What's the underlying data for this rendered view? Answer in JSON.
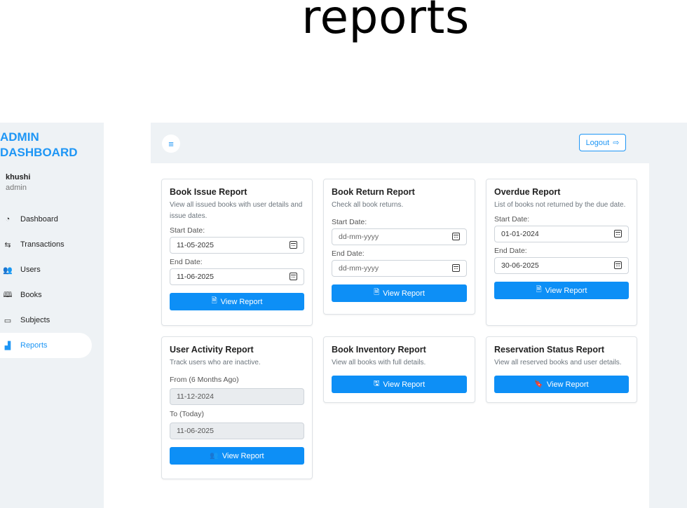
{
  "slide": {
    "title": "reports"
  },
  "sidebar": {
    "brand": "ADMIN DASHBOARD",
    "user": {
      "name": "khushi",
      "role": "admin"
    },
    "items": [
      {
        "label": "Dashboard",
        "icon": "gauge-icon"
      },
      {
        "label": "Transactions",
        "icon": "swap-icon"
      },
      {
        "label": "Users",
        "icon": "users-icon"
      },
      {
        "label": "Books",
        "icon": "book-icon"
      },
      {
        "label": "Subjects",
        "icon": "box-icon"
      },
      {
        "label": "Reports",
        "icon": "bar-chart-icon",
        "active": true
      }
    ]
  },
  "header": {
    "logout_label": "Logout"
  },
  "reports": {
    "issue": {
      "title": "Book Issue Report",
      "desc": "View all issued books with user details and issue dates.",
      "start_label": "Start Date:",
      "start_value": "11-05-2025",
      "end_label": "End Date:",
      "end_value": "11-06-2025",
      "button": "View Report"
    },
    "return": {
      "title": "Book Return Report",
      "desc": "Check all book returns.",
      "start_label": "Start Date:",
      "start_placeholder": "dd-mm-yyyy",
      "end_label": "End Date:",
      "end_placeholder": "dd-mm-yyyy",
      "button": "View Report"
    },
    "overdue": {
      "title": "Overdue Report",
      "desc": "List of books not returned by the due date.",
      "start_label": "Start Date:",
      "start_value": "01-01-2024",
      "end_label": "End Date:",
      "end_value": "30-06-2025",
      "button": "View Report"
    },
    "activity": {
      "title": "User Activity Report",
      "desc": "Track users who are inactive.",
      "from_label": "From (6 Months Ago)",
      "from_value": "11-12-2024",
      "to_label": "To (Today)",
      "to_value": "11-06-2025",
      "button": "View Report"
    },
    "inventory": {
      "title": "Book Inventory Report",
      "desc": "View all books with full details.",
      "button": "View Report"
    },
    "reservation": {
      "title": "Reservation Status Report",
      "desc": "View all reserved books and user details.",
      "button": "View Report"
    }
  },
  "colors": {
    "accent": "#0d8ff6",
    "sidebar_bg": "#eef2f5"
  }
}
